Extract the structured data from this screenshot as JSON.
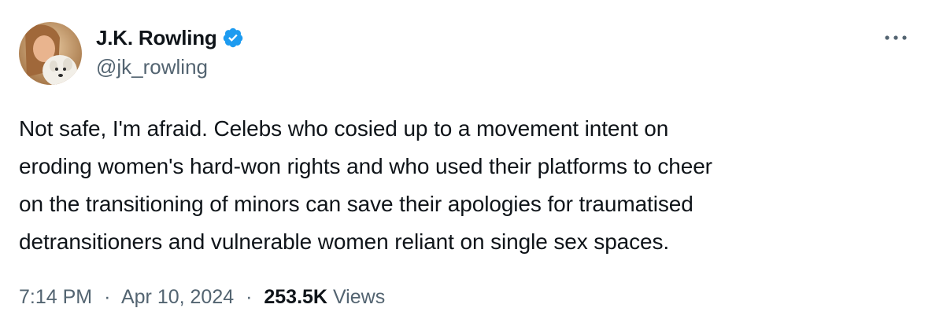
{
  "author": {
    "display_name": "J.K. Rowling",
    "handle": "@jk_rowling",
    "verified": true,
    "verified_color": "#1d9bf0"
  },
  "tweet": {
    "text": "Not safe, I'm afraid. Celebs who cosied up to a movement intent on\neroding women's hard-won rights and who used their platforms to cheer\non the transitioning of minors can save their apologies for traumatised\ndetransitioners and vulnerable women reliant on single sex spaces.",
    "time": "7:14 PM",
    "date": "Apr 10, 2024",
    "views_count": "253.5K",
    "views_label": "Views",
    "separator": "·"
  },
  "icons": {
    "verified": "verified-badge-icon",
    "more": "more-horizontal-icon",
    "avatar": "profile-photo"
  },
  "colors": {
    "text_primary": "#0f1419",
    "text_secondary": "#536471",
    "accent": "#1d9bf0"
  }
}
